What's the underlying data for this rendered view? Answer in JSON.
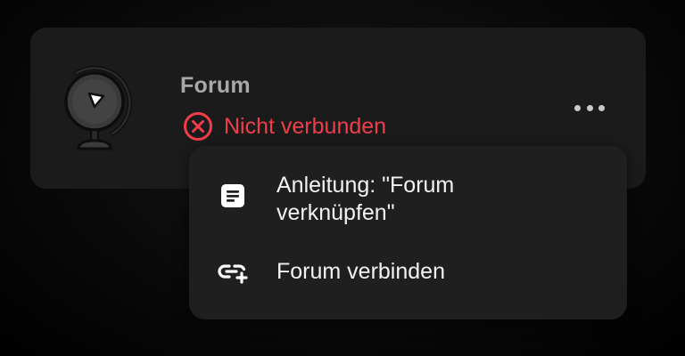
{
  "card": {
    "title": "Forum",
    "status": {
      "text": "Nicht verbunden",
      "icon": "error-circle-x-icon",
      "color": "#ef3e4a"
    },
    "logo_icon": "globe-icon",
    "more_icon": "more-horizontal-icon"
  },
  "menu": {
    "items": [
      {
        "label": "Anleitung: \"Forum\nverknüpfen\"",
        "icon": "document-icon"
      },
      {
        "label": "Forum verbinden",
        "icon": "link-add-icon"
      }
    ]
  },
  "colors": {
    "card_bg": "#1b1b1b",
    "menu_bg": "#1f1f1f",
    "title": "#a8a8a8",
    "menu_text": "#f2f2f2"
  }
}
